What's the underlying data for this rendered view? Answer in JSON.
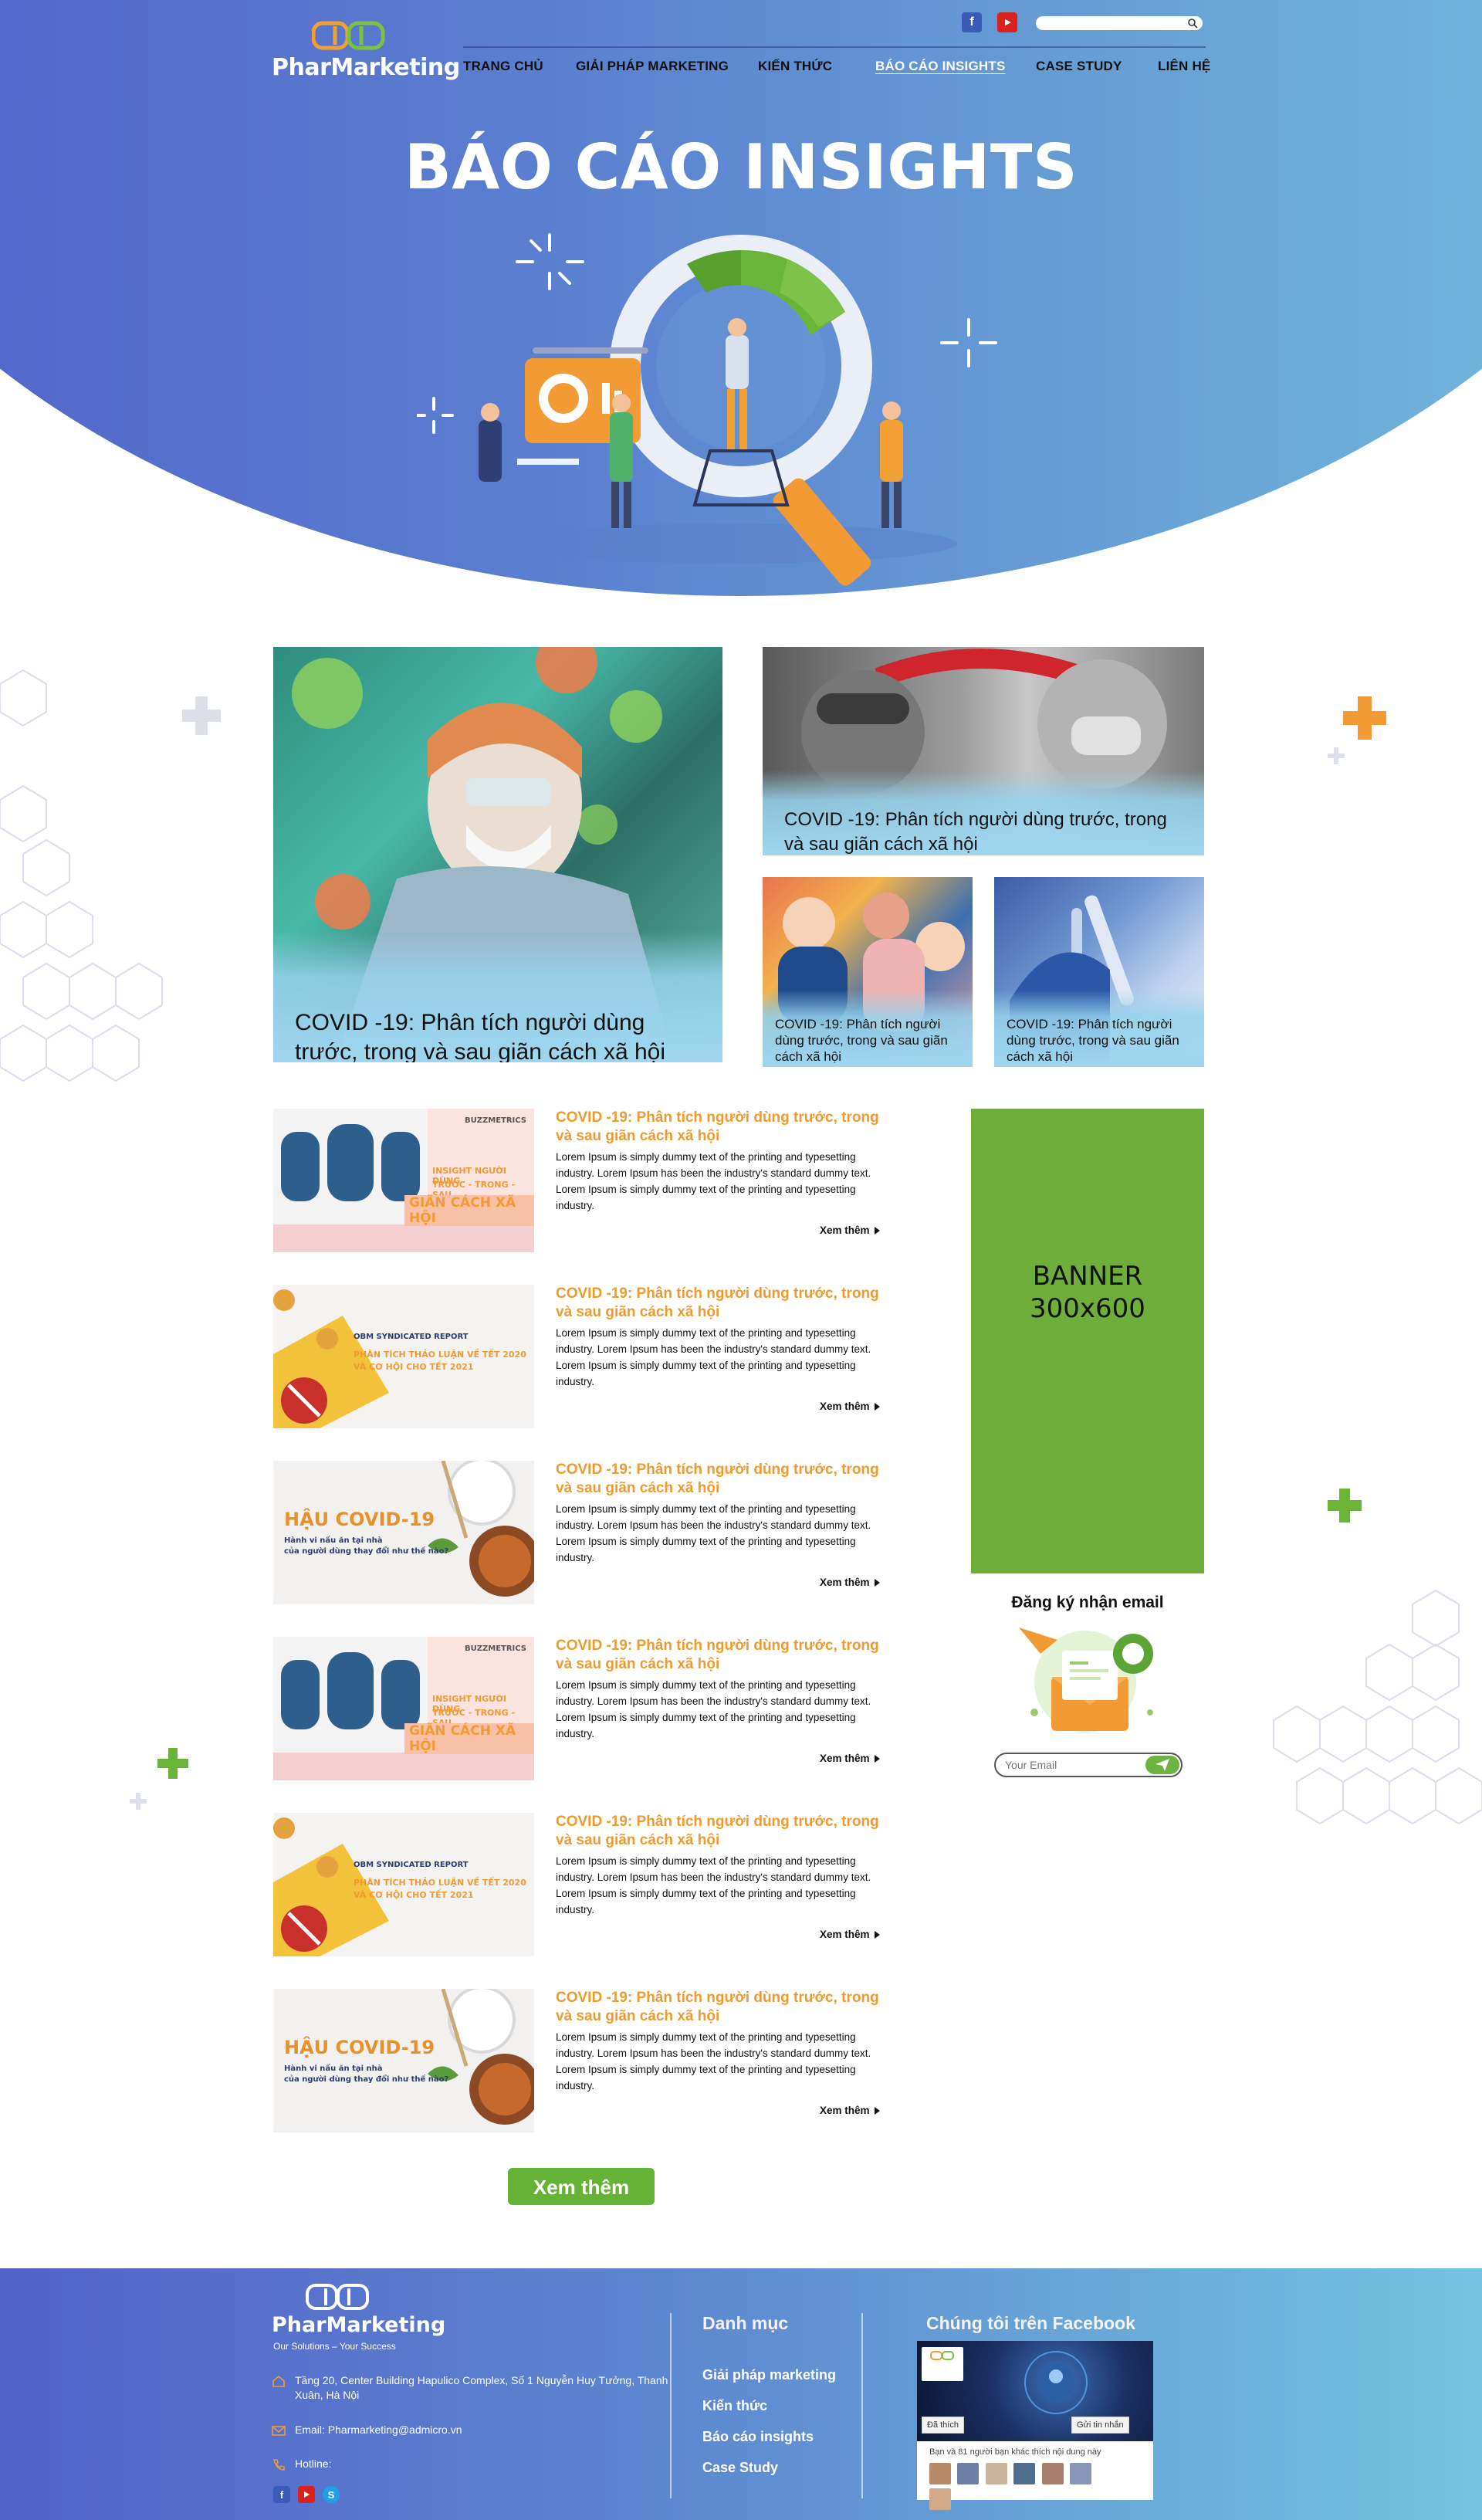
{
  "brand": {
    "name": "PharMarketing",
    "slogan": "Our Solutions – Your Success"
  },
  "nav": {
    "items": [
      "TRANG CHỦ",
      "GIẢI PHÁP MARKETING",
      "KIẾN THỨC",
      "BÁO CÁO INSIGHTS",
      "CASE STUDY",
      "LIÊN HỆ"
    ],
    "active": "BÁO CÁO INSIGHTS"
  },
  "search": {
    "placeholder": ""
  },
  "hero": {
    "title": "BÁO CÁO INSIGHTS"
  },
  "featured": {
    "main": "COVID -19: Phân tích người dùng trước, trong và sau giãn cách xã hội",
    "top": "COVID -19: Phân tích người dùng trước, trong và sau giãn cách xã hội",
    "small_1": "COVID -19: Phân tích người dùng trước, trong và sau giãn cách xã hội",
    "small_2": "COVID -19: Phân tích người dùng trước, trong và sau giãn cách xã hội"
  },
  "articles": [
    {
      "title": "COVID -19: Phân tích người dùng trước, trong và sau giãn cách xã hội",
      "body": "Lorem Ipsum is simply dummy text of the printing and typesetting industry. Lorem Ipsum has been the industry's standard dummy text. Lorem Ipsum is simply dummy text of the printing and typesetting industry.",
      "more": "Xem thêm",
      "thumb": {
        "brand": "BUZZMETRICS",
        "line1": "INSIGHT NGƯỜI DÙNG",
        "line2": "TRƯỚC - TRONG - SAU",
        "line3": "GIÃN CÁCH XÃ HỘI"
      }
    },
    {
      "title": "COVID -19: Phân tích người dùng trước, trong và sau giãn cách xã hội",
      "body": "Lorem Ipsum is simply dummy text of the printing and typesetting industry. Lorem Ipsum has been the industry's standard dummy text. Lorem Ipsum is simply dummy text of the printing and typesetting industry.",
      "more": "Xem thêm",
      "thumb": {
        "line1": "OBM SYNDICATED REPORT",
        "line2": "PHÂN TÍCH THẢO LUẬN VỀ TẾT 2020",
        "line3": "VÀ CƠ HỘI CHO TẾT 2021"
      }
    },
    {
      "title": "COVID -19: Phân tích người dùng trước, trong và sau giãn cách xã hội",
      "body": "Lorem Ipsum is simply dummy text of the printing and typesetting industry. Lorem Ipsum has been the industry's standard dummy text. Lorem Ipsum is simply dummy text of the printing and typesetting industry.",
      "more": "Xem thêm",
      "thumb": {
        "line1": "HẬU COVID-19",
        "line2": "Hành vi nấu ăn tại nhà",
        "line3": "của người dùng thay đổi như thế nào?"
      }
    },
    {
      "title": "COVID -19: Phân tích người dùng trước, trong và sau giãn cách xã hội",
      "body": "Lorem Ipsum is simply dummy text of the printing and typesetting industry. Lorem Ipsum has been the industry's standard dummy text. Lorem Ipsum is simply dummy text of the printing and typesetting industry.",
      "more": "Xem thêm",
      "thumb": {
        "brand": "BUZZMETRICS",
        "line1": "INSIGHT NGƯỜI DÙNG",
        "line2": "TRƯỚC - TRONG - SAU",
        "line3": "GIÃN CÁCH XÃ HỘI"
      }
    },
    {
      "title": "COVID -19: Phân tích người dùng trước, trong và sau giãn cách xã hội",
      "body": "Lorem Ipsum is simply dummy text of the printing and typesetting industry. Lorem Ipsum has been the industry's standard dummy text. Lorem Ipsum is simply dummy text of the printing and typesetting industry.",
      "more": "Xem thêm",
      "thumb": {
        "line1": "OBM SYNDICATED REPORT",
        "line2": "PHÂN TÍCH THẢO LUẬN VỀ TẾT 2020",
        "line3": "VÀ CƠ HỘI CHO TẾT 2021"
      }
    },
    {
      "title": "COVID -19: Phân tích người dùng trước, trong và sau giãn cách xã hội",
      "body": "Lorem Ipsum is simply dummy text of the printing and typesetting industry. Lorem Ipsum has been the industry's standard dummy text. Lorem Ipsum is simply dummy text of the printing and typesetting industry.",
      "more": "Xem thêm",
      "thumb": {
        "line1": "HẬU COVID-19",
        "line2": "Hành vi nấu ăn tại nhà",
        "line3": "của người dùng thay đổi như thế nào?"
      }
    }
  ],
  "load_more": "Xem thêm",
  "sidebar": {
    "banner_line1": "BANNER",
    "banner_line2": "300x600",
    "newsletter_title": "Đăng ký nhận email",
    "email_placeholder": "Your Email"
  },
  "footer": {
    "address": "Tầng 20, Center Building Hapulico Complex, Số 1 Nguyễn Huy Tưởng, Thanh Xuân, Hà Nội",
    "email": "Email: Pharmarketing@admicro.vn",
    "hotline": "Hotline:",
    "menu_heading": "Danh mục",
    "menu": [
      "Giải pháp marketing",
      "Kiến thức",
      "Báo cáo insights",
      "Case Study"
    ],
    "fb_heading": "Chúng tôi trên Facebook",
    "fb_like": "Đã thích",
    "fb_message": "Gửi tin nhắn",
    "fb_friends": "Bạn và 81 người bạn khác thích nội dung này"
  },
  "colors": {
    "hero_gradient_start": "#4f5fc9",
    "hero_gradient_end": "#74bfe0",
    "accent_orange": "#f09a2c",
    "accent_green": "#66b236",
    "banner_green": "#70ae3c"
  },
  "icons": [
    "facebook-icon",
    "youtube-icon",
    "search-icon",
    "location-icon",
    "email-icon",
    "phone-icon",
    "skype-icon",
    "send-icon"
  ]
}
